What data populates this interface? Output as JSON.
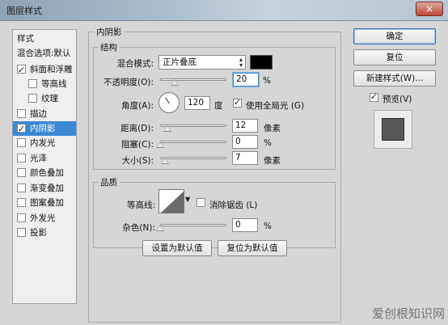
{
  "window": {
    "title": "图层样式",
    "close_label": "×"
  },
  "styles_panel": {
    "header": "样式",
    "blend_default": "混合选项:默认",
    "items": [
      {
        "label": "斜面和浮雕",
        "checked": true
      },
      {
        "label": "等高线",
        "checked": false
      },
      {
        "label": "纹理",
        "checked": false
      },
      {
        "label": "描边",
        "checked": false
      },
      {
        "label": "内阴影",
        "checked": true,
        "selected": true
      },
      {
        "label": "内发光",
        "checked": false
      },
      {
        "label": "光泽",
        "checked": false
      },
      {
        "label": "颜色叠加",
        "checked": false
      },
      {
        "label": "渐变叠加",
        "checked": false
      },
      {
        "label": "图案叠加",
        "checked": false
      },
      {
        "label": "外发光",
        "checked": false
      },
      {
        "label": "投影",
        "checked": false
      }
    ]
  },
  "inner_shadow": {
    "section_title": "内阴影",
    "structure_title": "结构",
    "blend_mode_label": "混合模式:",
    "blend_mode_value": "正片叠底",
    "shadow_color": "#000000",
    "opacity_label": "不透明度(O):",
    "opacity_value": "20",
    "opacity_unit": "%",
    "angle_label": "角度(A):",
    "angle_value": "120",
    "angle_unit": "度",
    "global_light_label": "使用全局光 (G)",
    "global_light_checked": true,
    "distance_label": "距离(D):",
    "distance_value": "12",
    "distance_unit": "像素",
    "choke_label": "阻塞(C):",
    "choke_value": "0",
    "choke_unit": "%",
    "size_label": "大小(S):",
    "size_value": "7",
    "size_unit": "像素",
    "quality_title": "品质",
    "contour_label": "等高线:",
    "anti_alias_label": "消除锯齿 (L)",
    "anti_alias_checked": false,
    "noise_label": "杂色(N):",
    "noise_value": "0",
    "noise_unit": "%",
    "set_default_label": "设置为默认值",
    "reset_default_label": "复位为默认值"
  },
  "actions": {
    "ok_label": "确定",
    "reset_label": "复位",
    "new_style_label": "新建样式(W)...",
    "preview_label": "预览(V)",
    "preview_checked": true
  },
  "watermark": "爱创根知识网"
}
